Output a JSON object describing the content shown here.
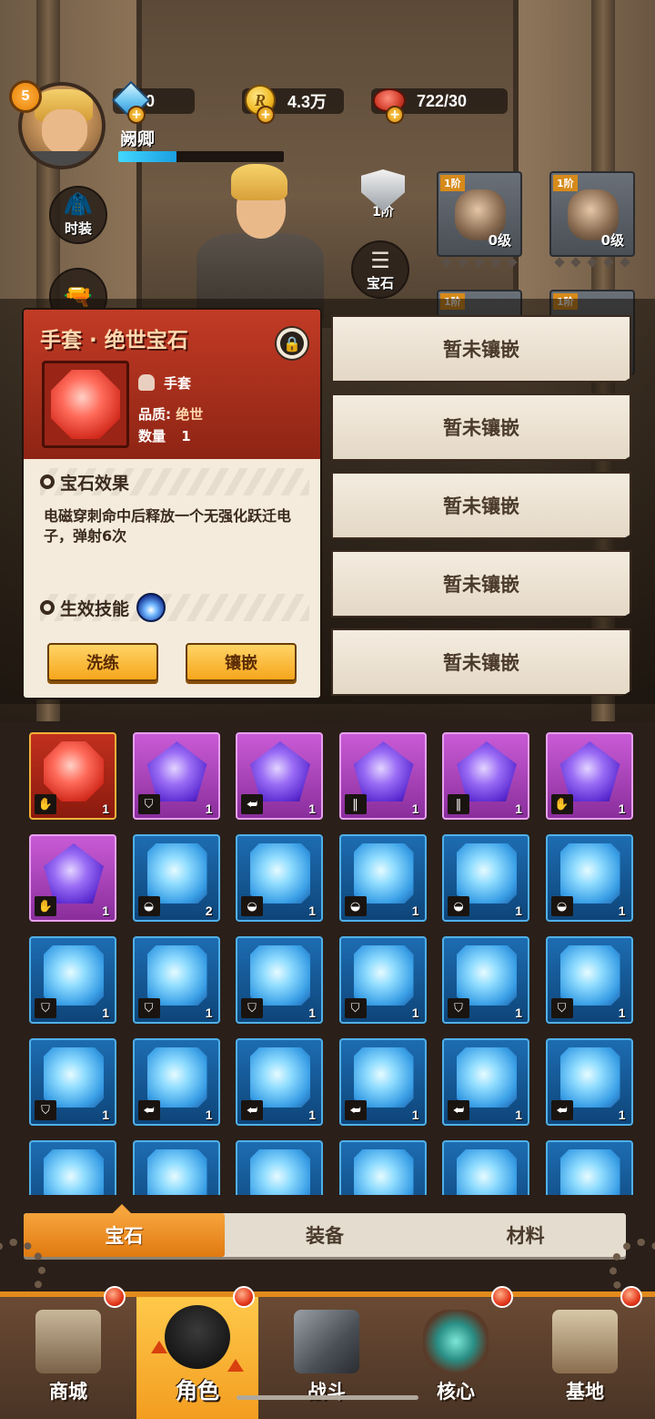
{
  "player": {
    "level": "5",
    "name": "阙卿",
    "exp_progress": 0.35
  },
  "resources": [
    {
      "name": "diamond",
      "value": "0"
    },
    {
      "name": "coin",
      "value": "4.3万"
    },
    {
      "name": "stamina",
      "value": "722/30"
    }
  ],
  "side_buttons": {
    "outfit": "时装",
    "gem": "宝石"
  },
  "rank": {
    "label": "1阶"
  },
  "equipment": [
    {
      "tier": "1阶",
      "level": "0级",
      "item": "helmet"
    },
    {
      "tier": "1阶",
      "level": "0级",
      "item": "gloves"
    },
    {
      "tier": "1阶",
      "level": "",
      "item": "armor"
    },
    {
      "tier": "1阶",
      "level": "",
      "item": "boots"
    }
  ],
  "popup": {
    "title": "手套 · 绝世宝石",
    "slot_type": "手套",
    "quality_label": "品质:",
    "quality_value": "绝世",
    "count_label": "数量",
    "count_value": "1",
    "effect_title": "宝石效果",
    "effect_text": "电磁穿刺命中后释放一个无强化跃迁电子，弹射6次",
    "skill_title": "生效技能",
    "btn_refine": "洗练",
    "btn_inlay": "镶嵌"
  },
  "inlay_slots": [
    "暂未镶嵌",
    "暂未镶嵌",
    "暂未镶嵌",
    "暂未镶嵌",
    "暂未镶嵌"
  ],
  "inventory": [
    {
      "color": "red",
      "slot": "glove",
      "count": "1"
    },
    {
      "color": "purple",
      "slot": "armor",
      "count": "1"
    },
    {
      "color": "purple",
      "slot": "boots",
      "count": "1"
    },
    {
      "color": "purple",
      "slot": "pants",
      "count": "1"
    },
    {
      "color": "purple",
      "slot": "pants",
      "count": "1"
    },
    {
      "color": "purple",
      "slot": "glove",
      "count": "1"
    },
    {
      "color": "purple",
      "slot": "glove",
      "count": "1"
    },
    {
      "color": "blue",
      "slot": "helmet",
      "count": "2"
    },
    {
      "color": "blue",
      "slot": "helmet",
      "count": "1"
    },
    {
      "color": "blue",
      "slot": "helmet",
      "count": "1"
    },
    {
      "color": "blue",
      "slot": "helmet",
      "count": "1"
    },
    {
      "color": "blue",
      "slot": "helmet",
      "count": "1"
    },
    {
      "color": "blue",
      "slot": "armor",
      "count": "1"
    },
    {
      "color": "blue",
      "slot": "armor",
      "count": "1"
    },
    {
      "color": "blue",
      "slot": "armor",
      "count": "1"
    },
    {
      "color": "blue",
      "slot": "armor",
      "count": "1"
    },
    {
      "color": "blue",
      "slot": "armor",
      "count": "1"
    },
    {
      "color": "blue",
      "slot": "armor",
      "count": "1"
    },
    {
      "color": "blue",
      "slot": "armor",
      "count": "1"
    },
    {
      "color": "blue",
      "slot": "boots",
      "count": "1"
    },
    {
      "color": "blue",
      "slot": "boots",
      "count": "1"
    },
    {
      "color": "blue",
      "slot": "boots",
      "count": "1"
    },
    {
      "color": "blue",
      "slot": "boots",
      "count": "1"
    },
    {
      "color": "blue",
      "slot": "boots",
      "count": "1"
    },
    {
      "color": "blue",
      "slot": "",
      "count": ""
    },
    {
      "color": "blue",
      "slot": "",
      "count": ""
    },
    {
      "color": "blue",
      "slot": "",
      "count": ""
    },
    {
      "color": "blue",
      "slot": "",
      "count": ""
    },
    {
      "color": "blue",
      "slot": "",
      "count": ""
    },
    {
      "color": "blue",
      "slot": "",
      "count": ""
    }
  ],
  "tabs": [
    {
      "label": "宝石",
      "active": true
    },
    {
      "label": "装备",
      "active": false
    },
    {
      "label": "材料",
      "active": false
    }
  ],
  "nav": [
    {
      "label": "商城",
      "active": false,
      "badge": true,
      "icon": "shop-icon"
    },
    {
      "label": "角色",
      "active": true,
      "badge": true,
      "icon": "character-icon"
    },
    {
      "label": "战斗",
      "active": false,
      "badge": false,
      "icon": "battle-icon"
    },
    {
      "label": "核心",
      "active": false,
      "badge": true,
      "icon": "core-icon"
    },
    {
      "label": "基地",
      "active": false,
      "badge": true,
      "icon": "base-icon"
    }
  ],
  "colors": {
    "accent": "#f29b1e",
    "popup_header": "#c23b25",
    "rarity_red": "#c1301e",
    "rarity_purple": "#8a2e9c",
    "rarity_blue": "#1d6cb1"
  }
}
